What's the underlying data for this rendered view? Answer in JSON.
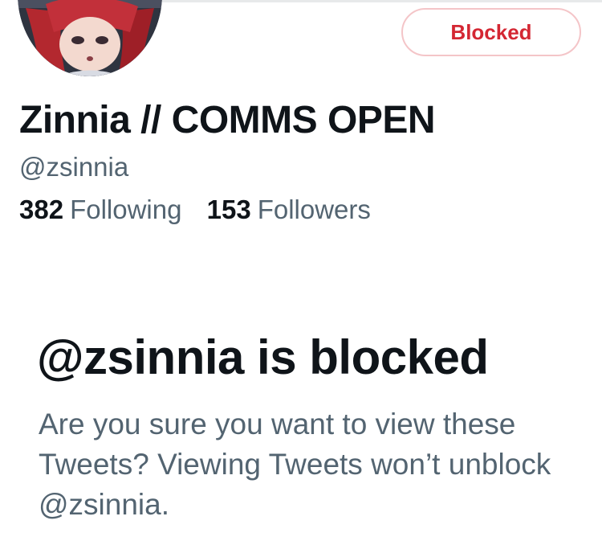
{
  "profile": {
    "display_name": "Zinnia // COMMS OPEN",
    "handle": "@zsinnia",
    "following_count": "382",
    "following_label": "Following",
    "followers_count": "153",
    "followers_label": "Followers"
  },
  "actions": {
    "blocked_label": "Blocked"
  },
  "blocked_notice": {
    "title": "@zsinnia is blocked",
    "body": "Are you sure you want to view these Tweets? Viewing Tweets won’t unblock @zsinnia."
  },
  "colors": {
    "text_primary": "#0f1419",
    "text_secondary": "#536471",
    "blocked_red": "#d42733",
    "blocked_border": "#f4c5c8"
  },
  "icons": {
    "avatar": "profile-avatar-anime-character"
  }
}
